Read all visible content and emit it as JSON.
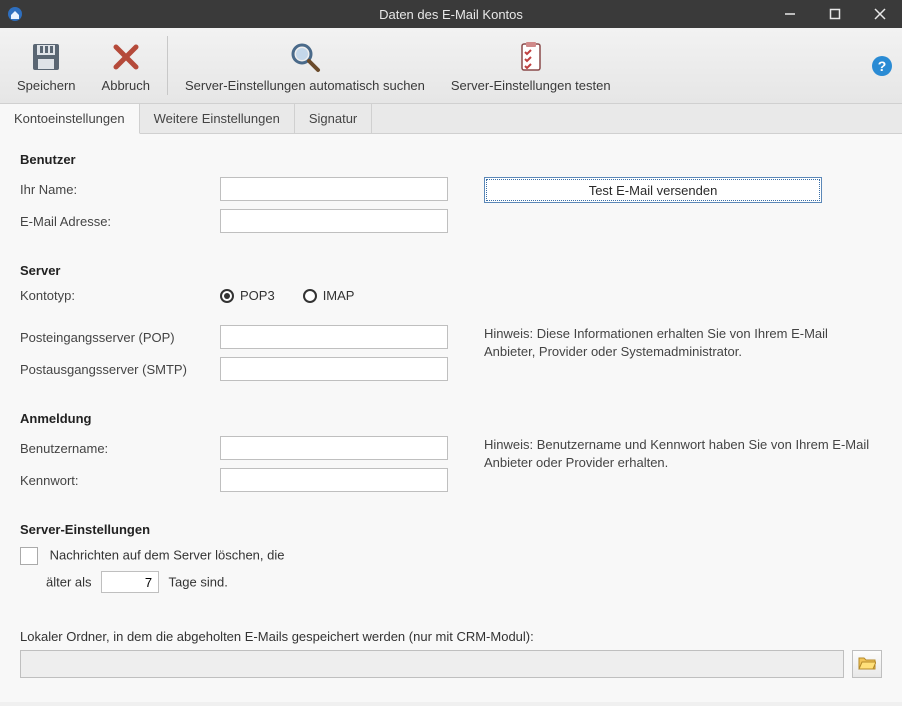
{
  "window": {
    "title": "Daten des E-Mail Kontos"
  },
  "toolbar": {
    "save": "Speichern",
    "cancel": "Abbruch",
    "autoDetect": "Server-Einstellungen automatisch suchen",
    "testServer": "Server-Einstellungen testen"
  },
  "tabs": {
    "account": "Kontoeinstellungen",
    "more": "Weitere Einstellungen",
    "signature": "Signatur"
  },
  "sections": {
    "user": "Benutzer",
    "server": "Server",
    "login": "Anmeldung",
    "serverSettings": "Server-Einstellungen"
  },
  "labels": {
    "yourName": "Ihr Name:",
    "emailAddress": "E-Mail Adresse:",
    "accountType": "Kontotyp:",
    "incomingServer": "Posteingangsserver (POP)",
    "outgoingServer": "Postausgangsserver (SMTP)",
    "username": "Benutzername:",
    "password": "Kennwort:",
    "deleteMsgs_pre": "Nachrichten auf dem Server löschen, die",
    "deleteMsgs_mid": "älter als",
    "deleteMsgs_post": "Tage sind.",
    "localFolder": "Lokaler Ordner, in dem die abgeholten E-Mails gespeichert werden (nur mit CRM-Modul):"
  },
  "radios": {
    "pop3": "POP3",
    "imap": "IMAP",
    "selected": "pop3"
  },
  "buttons": {
    "sendTest": "Test E-Mail versenden"
  },
  "hints": {
    "serverHint": "Hinweis: Diese Informationen erhalten Sie von Ihrem E-Mail Anbieter, Provider oder Systemadministrator.",
    "loginHint": "Hinweis: Benutzername und Kennwort haben Sie von Ihrem  E-Mail Anbieter oder Provider erhalten."
  },
  "values": {
    "yourName": "",
    "email": "",
    "incoming": "",
    "outgoing": "",
    "username": "",
    "password": "",
    "daysOld": "7",
    "deleteChecked": false,
    "localFolder": ""
  }
}
